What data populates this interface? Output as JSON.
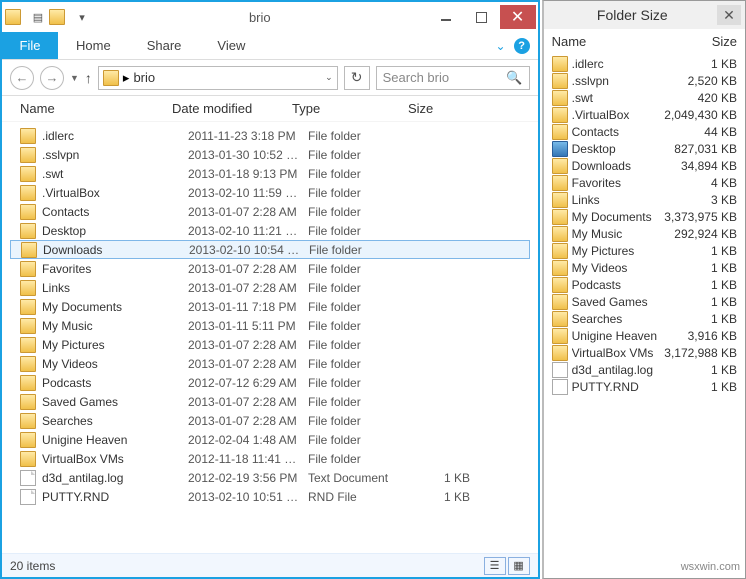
{
  "title": "brio",
  "tabs": {
    "file": "File",
    "home": "Home",
    "share": "Share",
    "view": "View"
  },
  "address": {
    "crumb": "brio"
  },
  "search": {
    "placeholder": "Search brio"
  },
  "columns": {
    "name": "Name",
    "date": "Date modified",
    "type": "Type",
    "size": "Size"
  },
  "selected_index": 6,
  "items": [
    {
      "name": ".idlerc",
      "date": "2011-11-23 3:18 PM",
      "type": "File folder",
      "size": "",
      "icon": "folder"
    },
    {
      "name": ".sslvpn",
      "date": "2013-01-30 10:52 …",
      "type": "File folder",
      "size": "",
      "icon": "folder"
    },
    {
      "name": ".swt",
      "date": "2013-01-18 9:13 PM",
      "type": "File folder",
      "size": "",
      "icon": "folder"
    },
    {
      "name": ".VirtualBox",
      "date": "2013-02-10 11:59 …",
      "type": "File folder",
      "size": "",
      "icon": "folder"
    },
    {
      "name": "Contacts",
      "date": "2013-01-07 2:28 AM",
      "type": "File folder",
      "size": "",
      "icon": "folder"
    },
    {
      "name": "Desktop",
      "date": "2013-02-10 11:21 …",
      "type": "File folder",
      "size": "",
      "icon": "folder"
    },
    {
      "name": "Downloads",
      "date": "2013-02-10 10:54 …",
      "type": "File folder",
      "size": "",
      "icon": "folder"
    },
    {
      "name": "Favorites",
      "date": "2013-01-07 2:28 AM",
      "type": "File folder",
      "size": "",
      "icon": "folder"
    },
    {
      "name": "Links",
      "date": "2013-01-07 2:28 AM",
      "type": "File folder",
      "size": "",
      "icon": "folder"
    },
    {
      "name": "My Documents",
      "date": "2013-01-11 7:18 PM",
      "type": "File folder",
      "size": "",
      "icon": "folder"
    },
    {
      "name": "My Music",
      "date": "2013-01-11 5:11 PM",
      "type": "File folder",
      "size": "",
      "icon": "folder"
    },
    {
      "name": "My Pictures",
      "date": "2013-01-07 2:28 AM",
      "type": "File folder",
      "size": "",
      "icon": "folder"
    },
    {
      "name": "My Videos",
      "date": "2013-01-07 2:28 AM",
      "type": "File folder",
      "size": "",
      "icon": "folder"
    },
    {
      "name": "Podcasts",
      "date": "2012-07-12 6:29 AM",
      "type": "File folder",
      "size": "",
      "icon": "folder"
    },
    {
      "name": "Saved Games",
      "date": "2013-01-07 2:28 AM",
      "type": "File folder",
      "size": "",
      "icon": "folder"
    },
    {
      "name": "Searches",
      "date": "2013-01-07 2:28 AM",
      "type": "File folder",
      "size": "",
      "icon": "folder"
    },
    {
      "name": "Unigine Heaven",
      "date": "2012-02-04 1:48 AM",
      "type": "File folder",
      "size": "",
      "icon": "folder"
    },
    {
      "name": "VirtualBox VMs",
      "date": "2012-11-18 11:41 …",
      "type": "File folder",
      "size": "",
      "icon": "folder"
    },
    {
      "name": "d3d_antilag.log",
      "date": "2012-02-19 3:56 PM",
      "type": "Text Document",
      "size": "1 KB",
      "icon": "file"
    },
    {
      "name": "PUTTY.RND",
      "date": "2013-02-10 10:51 …",
      "type": "RND File",
      "size": "1 KB",
      "icon": "file"
    }
  ],
  "status": "20 items",
  "side": {
    "title": "Folder Size",
    "columns": {
      "name": "Name",
      "size": "Size"
    },
    "items": [
      {
        "name": ".idlerc",
        "size": "1 KB",
        "icon": "folder"
      },
      {
        "name": ".sslvpn",
        "size": "2,520 KB",
        "icon": "folder"
      },
      {
        "name": ".swt",
        "size": "420 KB",
        "icon": "folder"
      },
      {
        "name": ".VirtualBox",
        "size": "2,049,430 KB",
        "icon": "folder"
      },
      {
        "name": "Contacts",
        "size": "44 KB",
        "icon": "folder"
      },
      {
        "name": "Desktop",
        "size": "827,031 KB",
        "icon": "desktop"
      },
      {
        "name": "Downloads",
        "size": "34,894 KB",
        "icon": "folder"
      },
      {
        "name": "Favorites",
        "size": "4 KB",
        "icon": "folder"
      },
      {
        "name": "Links",
        "size": "3 KB",
        "icon": "folder"
      },
      {
        "name": "My Documents",
        "size": "3,373,975 KB",
        "icon": "folder"
      },
      {
        "name": "My Music",
        "size": "292,924 KB",
        "icon": "folder"
      },
      {
        "name": "My Pictures",
        "size": "1 KB",
        "icon": "folder"
      },
      {
        "name": "My Videos",
        "size": "1 KB",
        "icon": "folder"
      },
      {
        "name": "Podcasts",
        "size": "1 KB",
        "icon": "folder"
      },
      {
        "name": "Saved Games",
        "size": "1 KB",
        "icon": "folder"
      },
      {
        "name": "Searches",
        "size": "1 KB",
        "icon": "folder"
      },
      {
        "name": "Unigine Heaven",
        "size": "3,916 KB",
        "icon": "folder"
      },
      {
        "name": "VirtualBox VMs",
        "size": "3,172,988 KB",
        "icon": "folder"
      },
      {
        "name": "d3d_antilag.log",
        "size": "1 KB",
        "icon": "file"
      },
      {
        "name": "PUTTY.RND",
        "size": "1 KB",
        "icon": "file"
      }
    ]
  },
  "watermark": "wsxwin.com"
}
